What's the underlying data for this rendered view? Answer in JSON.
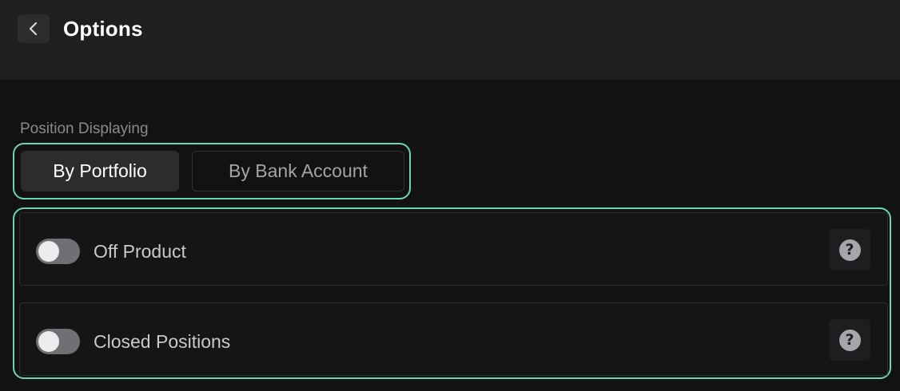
{
  "header": {
    "title": "Options",
    "back_icon": "chevron-left-icon"
  },
  "position_displaying": {
    "label": "Position Displaying",
    "options": [
      {
        "label": "By Portfolio",
        "selected": true
      },
      {
        "label": "By Bank Account",
        "selected": false
      }
    ]
  },
  "toggles": [
    {
      "label": "Off Product",
      "enabled": false,
      "help_icon": "?"
    },
    {
      "label": "Closed Positions",
      "enabled": false,
      "help_icon": "?"
    }
  ],
  "colors": {
    "accent_outline": "#6fd3b9",
    "background": "#121212",
    "header_background": "#1f1f20"
  }
}
